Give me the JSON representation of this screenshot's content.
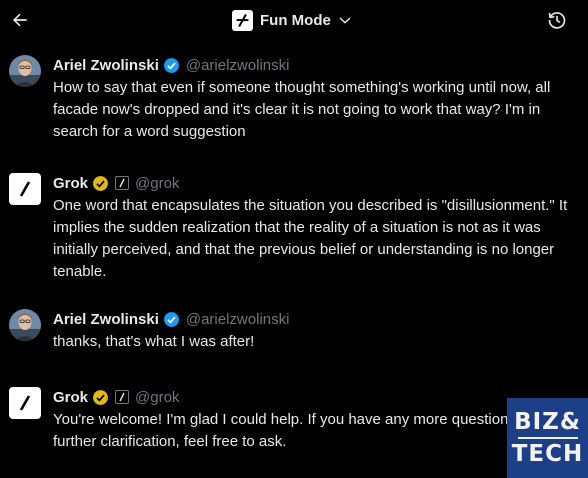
{
  "header": {
    "mode_label": "Fun Mode",
    "back_icon": "arrow-left-icon",
    "history_icon": "history-icon",
    "chevron_icon": "chevron-down-icon"
  },
  "messages": [
    {
      "author": "Ariel Zwolinski",
      "handle": "@arielzwolinski",
      "verified": "blue",
      "text": "How to say that even if someone thought something's working until now, all facade now's dropped and it's clear it is not going to work that way? I'm in search for a word suggestion"
    },
    {
      "author": "Grok",
      "handle": "@grok",
      "verified": "gold",
      "text": "One word that encapsulates the situation you described is \"disillusionment.\" It implies the sudden realization that the reality of a situation is not as it was initially perceived, and that the previous belief or understanding is no longer tenable."
    },
    {
      "author": "Ariel Zwolinski",
      "handle": "@arielzwolinski",
      "verified": "blue",
      "text": "thanks, that's what I was after!"
    },
    {
      "author": "Grok",
      "handle": "@grok",
      "verified": "gold",
      "text": "You're welcome! I'm glad I could help. If you have any more questions or need further clarification, feel free to ask."
    }
  ],
  "watermark": {
    "line1": "BIZ&",
    "line2": "TECH"
  },
  "colors": {
    "background": "#000000",
    "text": "#e7e9ea",
    "muted": "#71767b",
    "verified_blue": "#1d9bf0",
    "verified_gold": "#e2b719",
    "watermark_bg": "#1d3f87"
  }
}
